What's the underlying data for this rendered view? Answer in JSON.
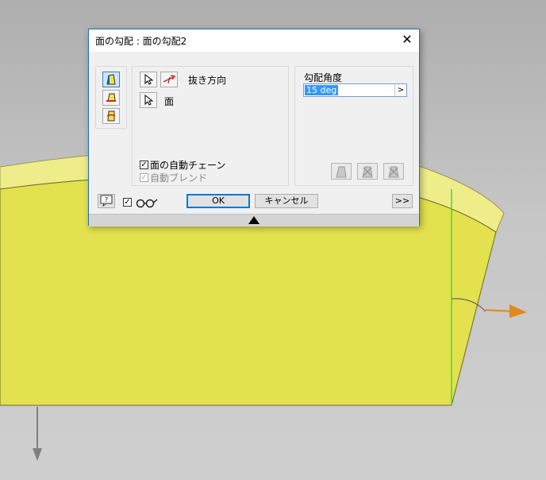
{
  "dialog": {
    "title": "面の勾配 : 面の勾配2",
    "close_glyph": "✕"
  },
  "selection": {
    "pull_direction_label": "抜き方向",
    "face_label": "面"
  },
  "options": {
    "auto_chain_label": "面の自動チェーン",
    "auto_chain_checked": true,
    "auto_blend_label": "自動ブレンド",
    "auto_blend_checked": true,
    "auto_blend_enabled": false
  },
  "angle": {
    "label": "勾配角度",
    "value": "15 deg",
    "arrow": ">"
  },
  "footer": {
    "ok_label": "OK",
    "cancel_label": "キャンセル",
    "more_label": ">>",
    "help_glyph": "?",
    "preview_checked": true
  },
  "icons": {
    "mode_fixed_edge": "fixed-edge-draft-icon",
    "mode_fixed_plane": "fixed-plane-draft-icon",
    "mode_parting_line": "parting-line-draft-icon",
    "select_arrow": "select-arrow-icon",
    "flip_direction": "flip-direction-icon",
    "preview": "glasses-icon"
  },
  "colors": {
    "face_yellow": "#e3e14e",
    "accent_blue": "#0078d7",
    "axis_green": "#3ddc3d",
    "arrow_orange": "#e08a1c",
    "flip_red": "#d62222"
  }
}
